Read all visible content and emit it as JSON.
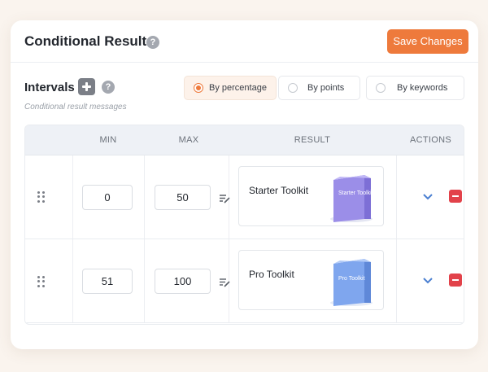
{
  "header": {
    "title": "Conditional Results",
    "help_glyph": "?",
    "save_label": "Save Changes"
  },
  "intervals": {
    "label": "Intervals",
    "help_glyph": "?",
    "subtitle": "Conditional result messages",
    "modes": [
      {
        "label": "By percentage",
        "selected": true
      },
      {
        "label": "By points",
        "selected": false
      },
      {
        "label": "By keywords",
        "selected": false
      }
    ]
  },
  "table": {
    "columns": {
      "min": "MIN",
      "max": "MAX",
      "result": "RESULT",
      "actions": "ACTIONS"
    },
    "rows": [
      {
        "min": "0",
        "max": "50",
        "result": "Starter Toolkit",
        "box_label": "Starter Toolkit",
        "box_color": "#9b8ee8"
      },
      {
        "min": "51",
        "max": "100",
        "result": "Pro Toolkit",
        "box_label": "Pro Toolkit",
        "box_color": "#7fa6ee"
      }
    ]
  },
  "colors": {
    "accent": "#ee7a3c",
    "danger": "#e2424a",
    "chevron": "#4a7fd1"
  },
  "icons": {
    "title_help": "question-circle-icon",
    "add": "plus-icon",
    "drag": "drag-handle-icon",
    "edit": "edit-lines-icon",
    "expand": "chevron-down-icon",
    "remove": "minus-square-icon"
  }
}
